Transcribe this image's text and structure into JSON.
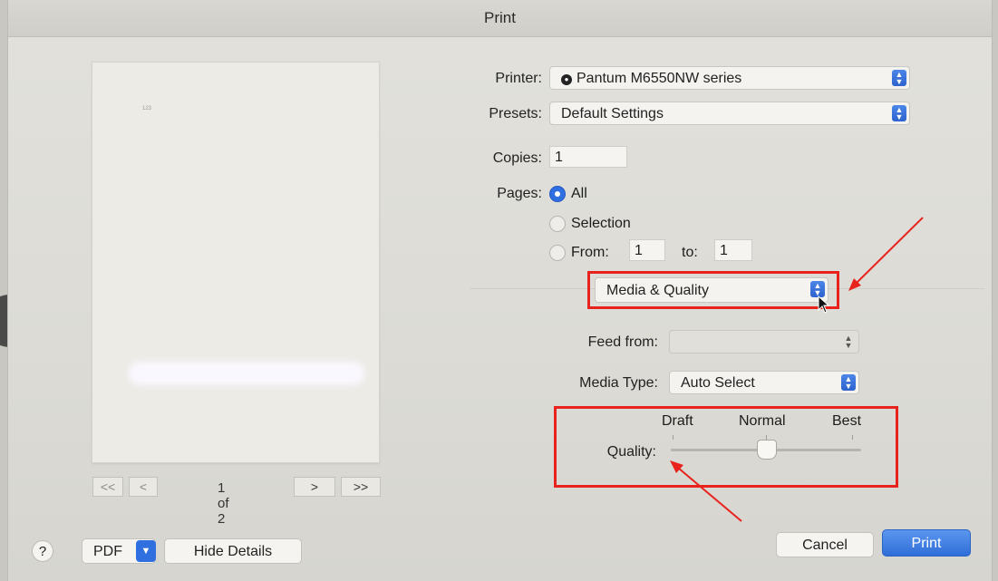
{
  "window": {
    "title": "Print"
  },
  "preview": {
    "page_mark": "123",
    "page_indicator": "1 of 2",
    "buttons": {
      "first": "<<",
      "prev": "<",
      "next": ">",
      "last": ">>"
    }
  },
  "printer": {
    "label": "Printer:",
    "value": "Pantum M6550NW series"
  },
  "presets": {
    "label": "Presets:",
    "value": "Default Settings"
  },
  "copies": {
    "label": "Copies:",
    "value": "1"
  },
  "pages": {
    "label": "Pages:",
    "options": {
      "all": "All",
      "selection": "Selection",
      "from": "From:",
      "to": "to:"
    },
    "selected": "All",
    "from_value": "1",
    "to_value": "1"
  },
  "section": {
    "value": "Media & Quality"
  },
  "feed_from": {
    "label": "Feed from:",
    "value": ""
  },
  "media_type": {
    "label": "Media Type:",
    "value": "Auto Select"
  },
  "quality": {
    "label": "Quality:",
    "levels": [
      "Draft",
      "Normal",
      "Best"
    ],
    "selected": "Normal",
    "position_fraction": 0.5
  },
  "footer": {
    "help": "?",
    "pdf": "PDF",
    "hide_details": "Hide Details",
    "cancel": "Cancel",
    "print": "Print"
  },
  "colors": {
    "accent": "#2f6fe0",
    "annotation": "#e8221d"
  },
  "icons": [
    "printer-icon",
    "stepper-icon",
    "help-icon",
    "chevron-down-icon",
    "cursor-icon"
  ]
}
